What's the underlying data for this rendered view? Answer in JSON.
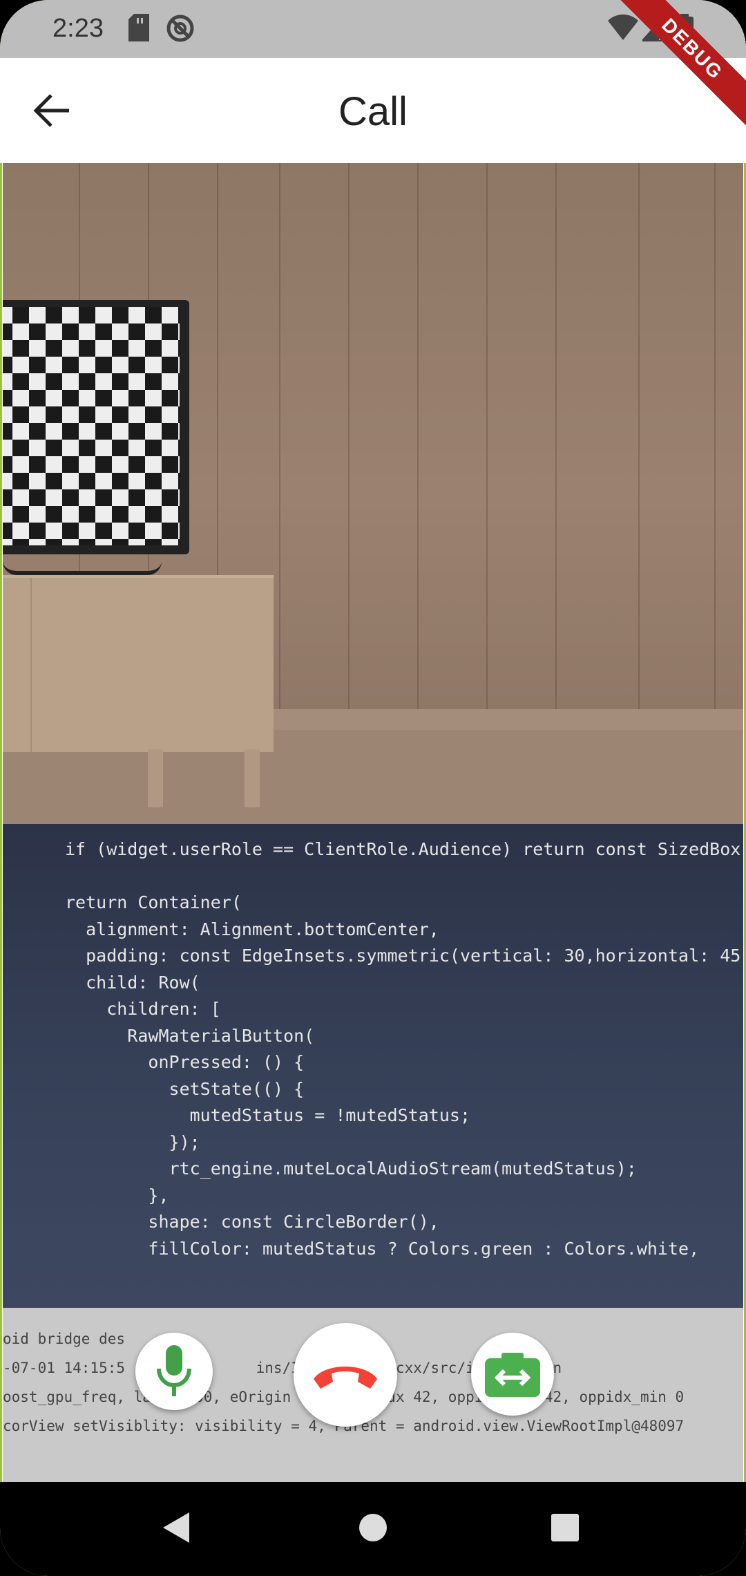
{
  "status_bar": {
    "time": "2:23"
  },
  "debug_banner": "DEBUG",
  "app_bar": {
    "title": "Call"
  },
  "icons": {
    "back": "arrow-left-icon",
    "mute": "microphone-icon",
    "end_call": "phone-hangup-icon",
    "switch_camera": "camera-switch-icon"
  },
  "colors": {
    "mic_green": "#43a047",
    "end_call_red": "#f44336",
    "switch_green": "#4caf50"
  },
  "remote_video": {
    "label": ""
  },
  "local_video": {
    "code_lines": [
      "if (widget.userRole == ClientRole.Audience) return const SizedBox",
      "",
      "return Container(",
      "  alignment: Alignment.bottomCenter,",
      "  padding: const EdgeInsets.symmetric(vertical: 30,horizontal: 45)",
      "  child: Row(",
      "    children: [",
      "      RawMaterialButton(",
      "        onPressed: () {",
      "          setState(() {",
      "            mutedStatus = !mutedStatus;",
      "          });",
      "          rtc_engine.muteLocalAudioStream(mutedStatus);",
      "        },",
      "        shape: const CircleBorder(),",
      "        fillColor: mutedStatus ? Colors.green : Colors.white,"
    ],
    "console_lines": [
      "oid bridge des",
      "-07-01 14:15:5   [debug]     ins/IRIS-     c/cxx/src/iris_rtc_en",
      "oost_gpu_freq, la    100, eOrigin 2, final_idx 42, oppidx_max 42, oppidx_min 0",
      "corView setVisiblity: visibility = 4, Parent = android.view.ViewRootImpl@48097"
    ]
  }
}
